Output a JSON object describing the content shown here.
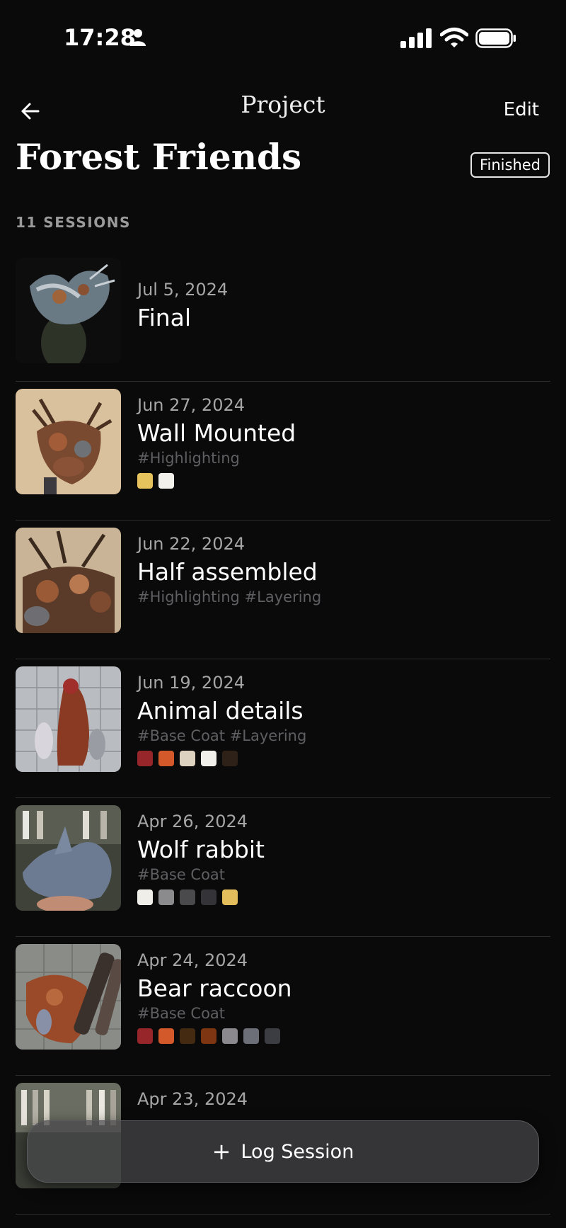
{
  "status_bar": {
    "time": "17:28"
  },
  "nav": {
    "title": "Project",
    "edit_label": "Edit"
  },
  "project": {
    "title": "Forest Friends",
    "status": "Finished",
    "sessions_count": "11 SESSIONS"
  },
  "sessions": [
    {
      "date": "Jul 5, 2024",
      "name": "Final",
      "tags": "",
      "swatches": []
    },
    {
      "date": "Jun 27, 2024",
      "name": "Wall Mounted",
      "tags": "#Highlighting",
      "swatches": [
        "#e7c35e",
        "#f3f1ec"
      ]
    },
    {
      "date": "Jun 22, 2024",
      "name": "Half assembled",
      "tags": "#Highlighting #Layering",
      "swatches": []
    },
    {
      "date": "Jun 19, 2024",
      "name": "Animal details",
      "tags": "#Base Coat #Layering",
      "swatches": [
        "#96262a",
        "#d4592a",
        "#ddd2c0",
        "#f1efea",
        "#2e2118"
      ]
    },
    {
      "date": "Apr 26, 2024",
      "name": "Wolf rabbit",
      "tags": "#Base Coat",
      "swatches": [
        "#f0eee9",
        "#8b8b8e",
        "#4a4a4d",
        "#343337",
        "#e3bd5c"
      ]
    },
    {
      "date": "Apr 24, 2024",
      "name": "Bear raccoon",
      "tags": "#Base Coat",
      "swatches": [
        "#96262a",
        "#d4592a",
        "#452a12",
        "#7e3512",
        "#8b898e",
        "#6c6e78",
        "#3b3d42"
      ]
    },
    {
      "date": "Apr 23, 2024",
      "name": "",
      "tags": "",
      "swatches": []
    }
  ],
  "log_button": {
    "label": "Log Session"
  }
}
